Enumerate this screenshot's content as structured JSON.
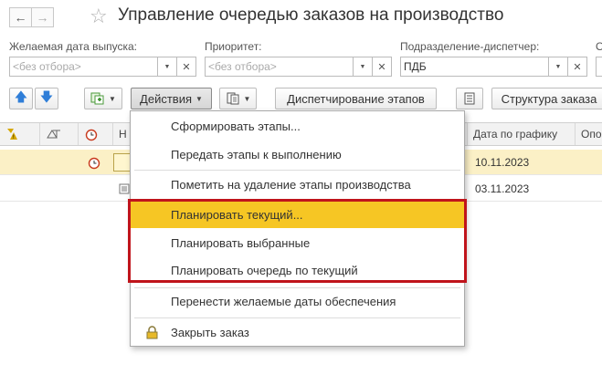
{
  "window": {
    "title": "Управление очередью заказов на производство"
  },
  "filters": {
    "date": {
      "label": "Желаемая дата выпуска:",
      "placeholder": "<без отбора>"
    },
    "priority": {
      "label": "Приоритет:",
      "placeholder": "<без отбора>"
    },
    "division": {
      "label": "Подразделение-диспетчер:",
      "value": "ПДБ"
    },
    "extra": {
      "label": "О"
    }
  },
  "toolbar": {
    "actions_label": "Действия",
    "dispatch_label": "Диспетчирование этапов",
    "structure_label": "Структура заказа"
  },
  "table": {
    "columns": [
      "Н",
      "Дата по графику",
      "Опо"
    ],
    "rows": [
      {
        "date": "10.11.2023",
        "selected": true
      },
      {
        "date": "03.11.2023",
        "selected": false
      }
    ]
  },
  "menu": {
    "items": [
      "Сформировать этапы...",
      "Передать этапы к выполнению",
      "Пометить на удаление этапы производства",
      "Планировать текущий...",
      "Планировать выбранные",
      "Планировать очередь по текущий",
      "Перенести желаемые даты обеспечения",
      "Закрыть заказ"
    ],
    "highlighted_index": 3,
    "highlight_color": "#f6c624",
    "frame_color": "#c0141b"
  }
}
